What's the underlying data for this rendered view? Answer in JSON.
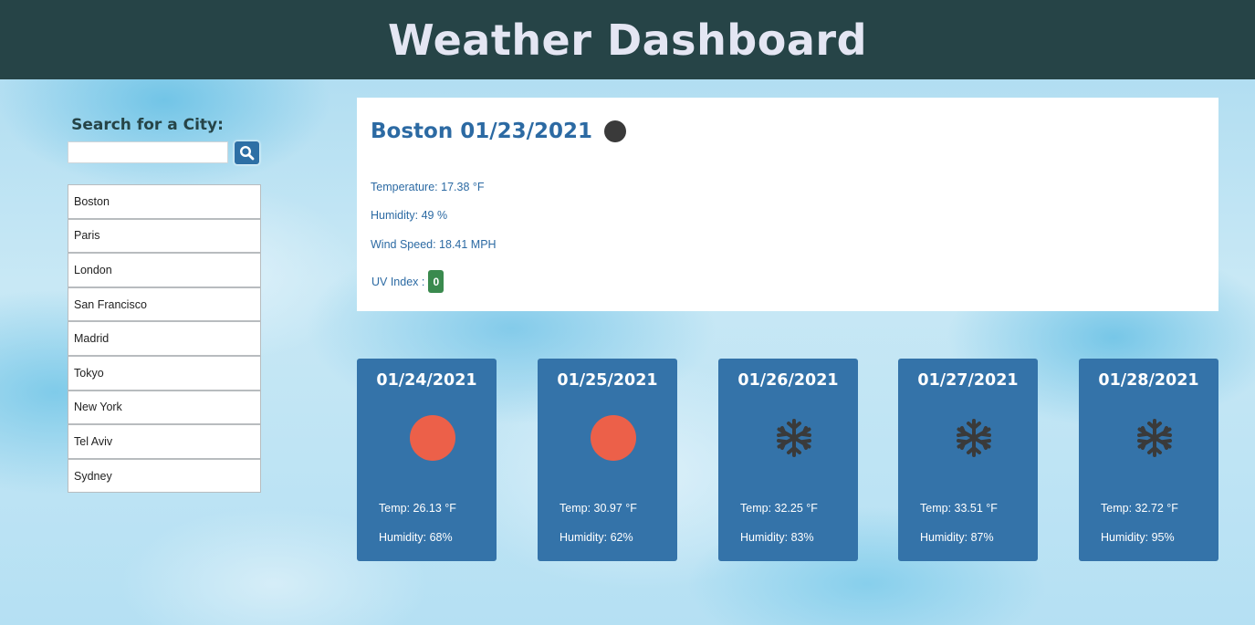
{
  "header": {
    "title": "Weather Dashboard"
  },
  "search": {
    "label": "Search for a City:",
    "value": "",
    "placeholder": "",
    "button_icon": "search-icon"
  },
  "history": [
    "Boston",
    "Paris",
    "London",
    "San Francisco",
    "Madrid",
    "Tokyo",
    "New York",
    "Tel Aviv",
    "Sydney"
  ],
  "current": {
    "title": "Boston 01/23/2021",
    "icon": "moon-icon",
    "temperature": "Temperature: 17.38 °F",
    "humidity": "Humidity: 49 %",
    "wind": "Wind Speed: 18.41 MPH",
    "uv_label": "UV Index :",
    "uv_value": "0",
    "uv_color": "#3a8a4e"
  },
  "forecast": [
    {
      "date": "01/24/2021",
      "icon": "sun-icon",
      "temp": "Temp: 26.13 °F",
      "humidity": "Humidity: 68%"
    },
    {
      "date": "01/25/2021",
      "icon": "sun-icon",
      "temp": "Temp: 30.97 °F",
      "humidity": "Humidity: 62%"
    },
    {
      "date": "01/26/2021",
      "icon": "snowflake-icon",
      "temp": "Temp: 32.25 °F",
      "humidity": "Humidity: 83%"
    },
    {
      "date": "01/27/2021",
      "icon": "snowflake-icon",
      "temp": "Temp: 33.51 °F",
      "humidity": "Humidity: 87%"
    },
    {
      "date": "01/28/2021",
      "icon": "snowflake-icon",
      "temp": "Temp: 32.72 °F",
      "humidity": "Humidity: 95%"
    }
  ],
  "colors": {
    "header_bg": "#264447",
    "title_text": "#e4e6f3",
    "card_bg": "#3473a9",
    "accent_text": "#2c6aa3",
    "sun": "#ec6049",
    "snow": "#3a3a3a"
  }
}
